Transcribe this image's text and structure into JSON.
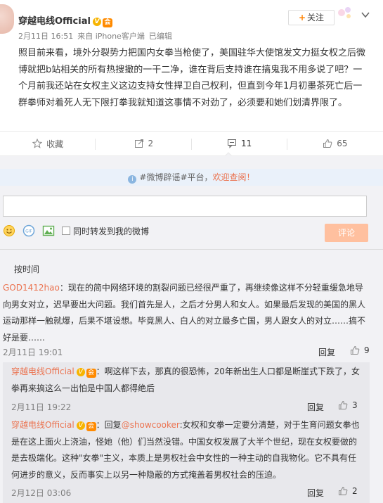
{
  "post": {
    "author": "穿越电线Official",
    "badge_text": "V",
    "vip_text": "会",
    "meta": {
      "date": "2月11日 16:51",
      "source": "来自 iPhone客户端",
      "edited": "已编辑"
    },
    "follow_label": "关注",
    "body": "照目前来看，境外分裂势力把国内女拳当枪使了，美国驻华大使馆发文力挺女权之后微博就把b站相关的所有热搜撤的一干二净，谁在背后支持谁在搞鬼我不用多说了吧？一个月前我还站在女权主义这边支持女性捍卫自己权利，但直到今年1月初墨茶死亡后一群拳师对着死人无下限打拳我就知道这事情不对劲了，必须要和她们划清界限了。"
  },
  "actions": {
    "favorite": "收藏",
    "repost": "2",
    "comment": "11",
    "like": "65"
  },
  "notice": {
    "prefix": "#微博辟谣#平台，",
    "link": "欢迎查阅！"
  },
  "compose": {
    "sync_label": "同时转发到我的微博",
    "submit_label": "评论"
  },
  "sort_label": "按时间",
  "comments": [
    {
      "user": "GOD1412hao",
      "text": "：现在的简中网络环境的割裂问题已经很严重了，再继续像这样不分轻重缓急地导向男女对立，迟早要出大问题。我们首先是人，之后才分男人和女人。如果最后发现的美国的黑人运动那样一触就爆，后果不堪设想。毕竟黑人、白人的对立最多亡国，男人跟女人的对立……搞不好是要……",
      "time": "2月11日 19:01",
      "reply": "回复",
      "likes": "9"
    }
  ],
  "sub_comments": [
    {
      "user": "穿越电线Official",
      "text": "：啊这样下去，那真的很恐怖，20年新出生人口都是断崖式下跌了，女拳再来搞这么一出怕是中国人都得绝后",
      "time": "2月11日 19:22",
      "reply": "回复",
      "likes": "3"
    },
    {
      "user": "穿越电线Official",
      "reply_prefix": "：回复",
      "mention": "@showcooker",
      "text": ":女权和女拳一定要分清楚，对于生育问题女拳也是在这上面火上浇油，怪她（他）们当然没错。中国女权发展了大半个世纪，现在女权要做的是去极端化。这种\"女拳\"主义，本质上是男权社会中女性的一种主动的自我物化。它不具有任何进步的意义，反而事实上以另一种隐蔽的方式掩盖着男权社会的压迫。",
      "time": "2月12日 03:06",
      "reply": "回复",
      "likes": "2"
    }
  ]
}
